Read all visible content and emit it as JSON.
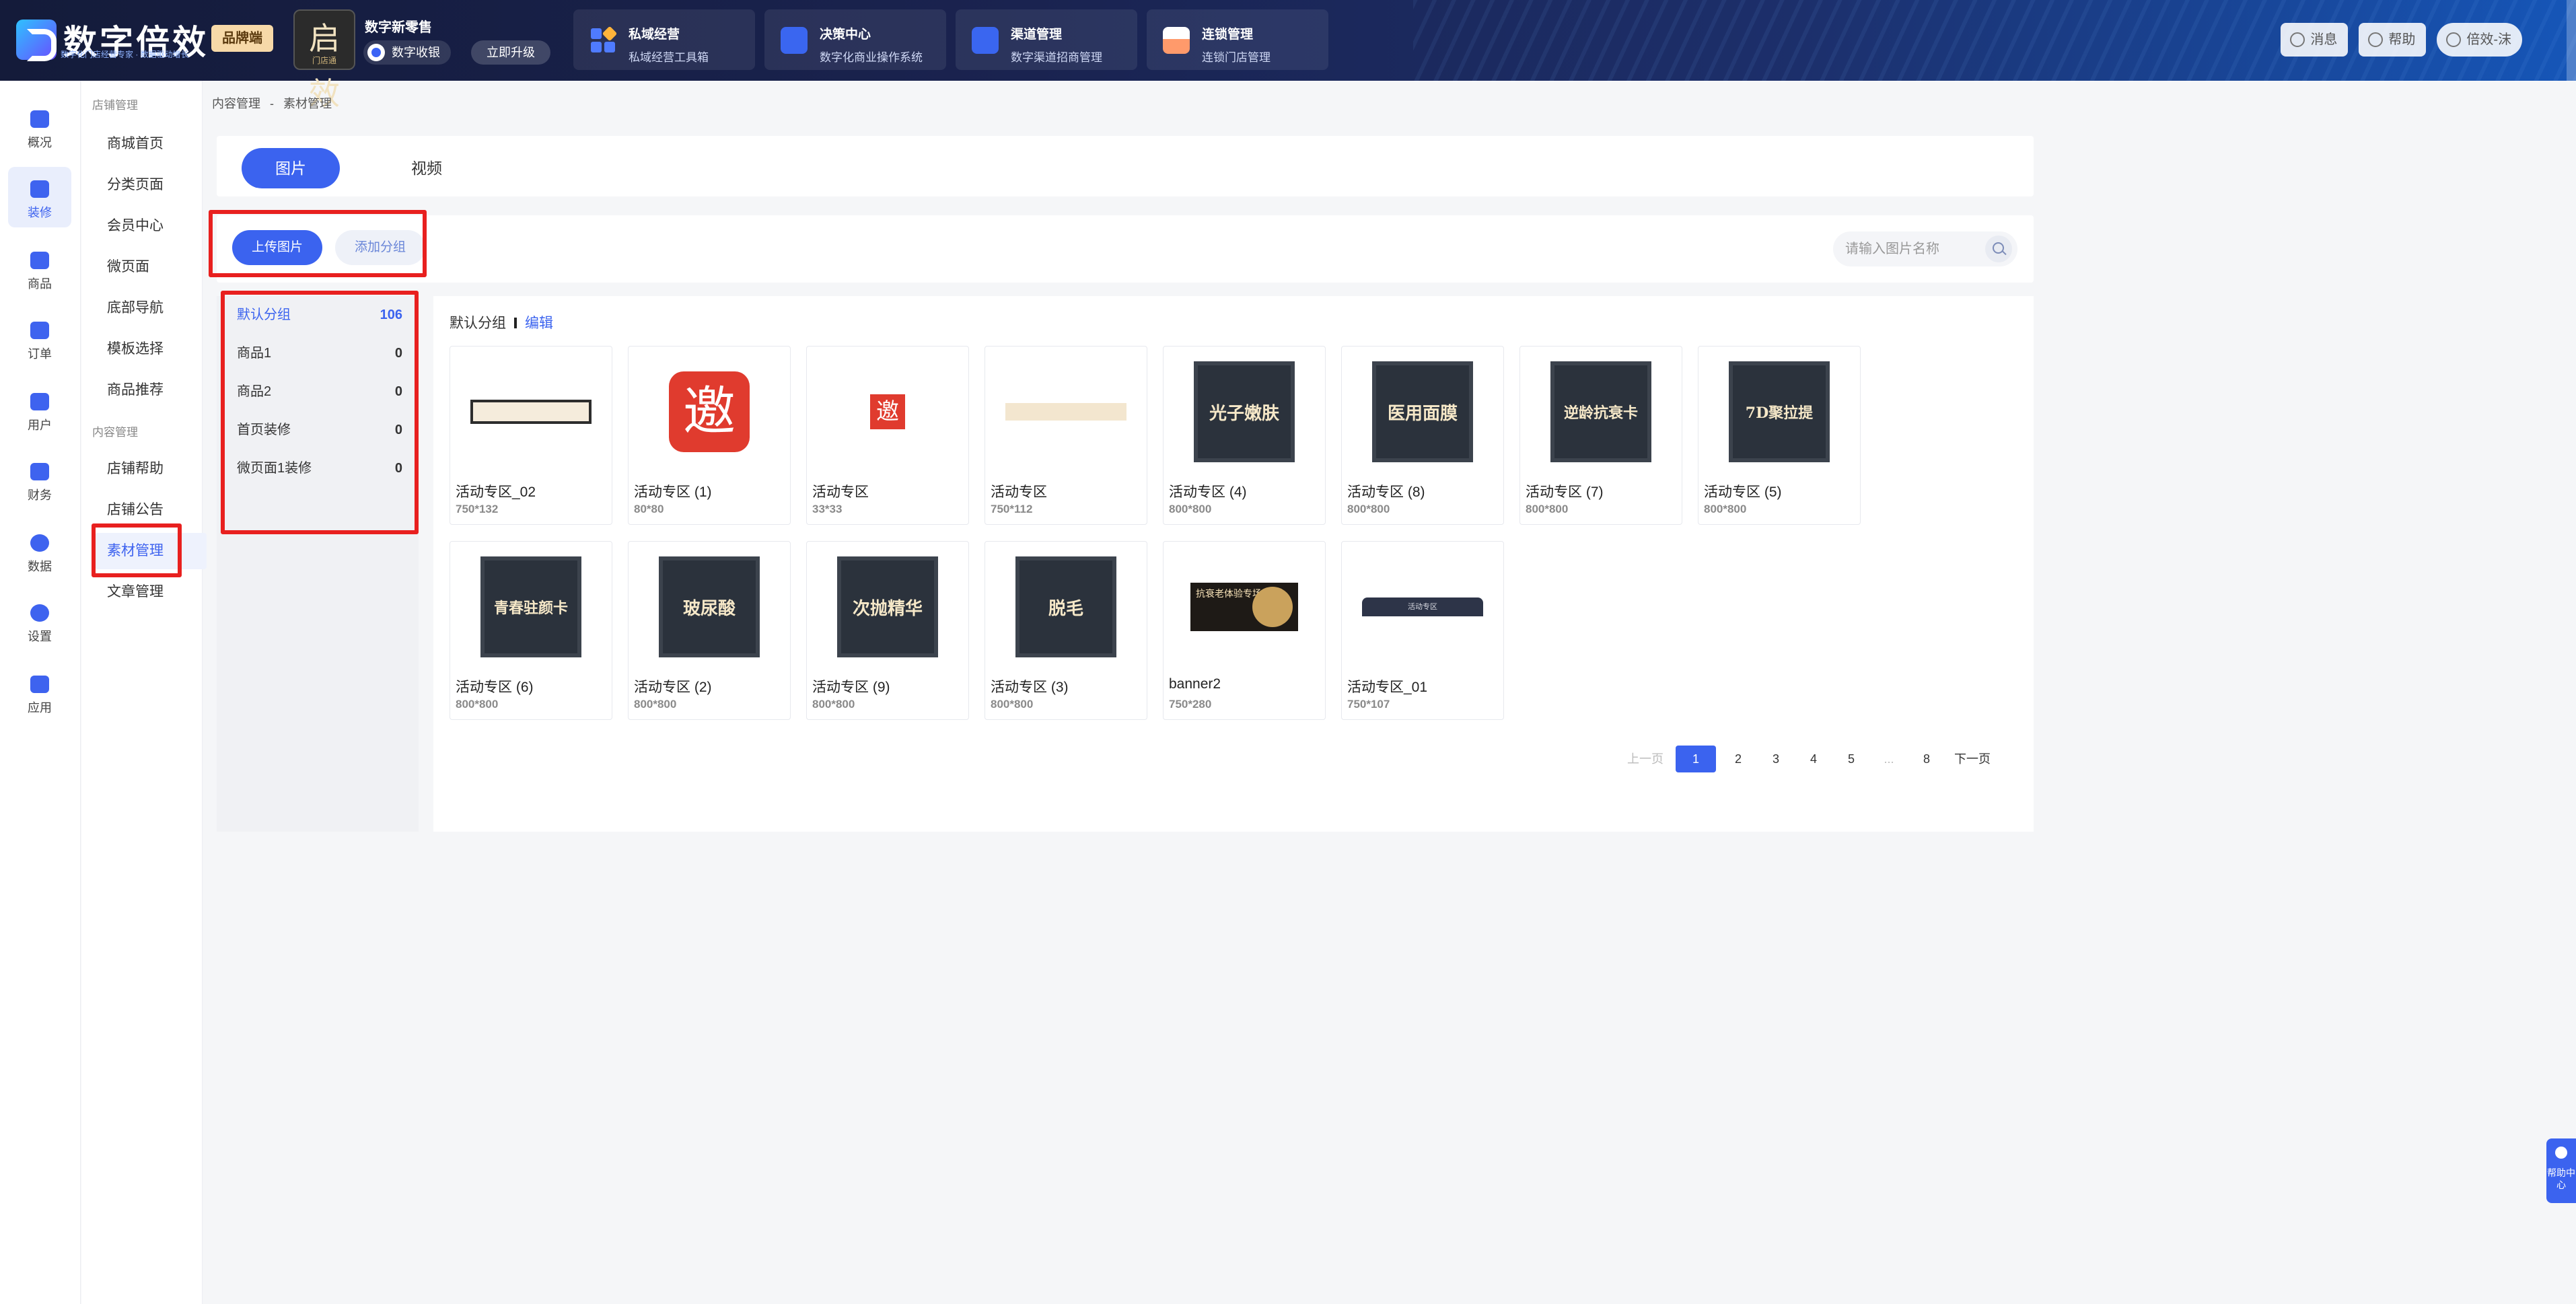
{
  "header": {
    "logo_text": "数字倍效",
    "logo_sub": "数字化门店经营专家 · 数据驱动增长",
    "brand_tag": "品牌端",
    "store_avatar_text": "启效",
    "store_avatar_sub": "门店通",
    "store_name": "数字新零售",
    "store_badge": "数字收银",
    "upgrade": "立即升级",
    "nav_cards": [
      {
        "title": "私域经营",
        "sub": "私域经营工具箱"
      },
      {
        "title": "决策中心",
        "sub": "数字化商业操作系统"
      },
      {
        "title": "渠道管理",
        "sub": "数字渠道招商管理"
      },
      {
        "title": "连锁管理",
        "sub": "连锁门店管理"
      }
    ],
    "actions": {
      "message": "消息",
      "help": "帮助",
      "user": "倍效-沫"
    }
  },
  "rail": [
    {
      "label": "概况"
    },
    {
      "label": "装修"
    },
    {
      "label": "商品"
    },
    {
      "label": "订单"
    },
    {
      "label": "用户"
    },
    {
      "label": "财务"
    },
    {
      "label": "数据"
    },
    {
      "label": "设置"
    },
    {
      "label": "应用"
    }
  ],
  "menu": {
    "group1": "店铺管理",
    "items1": [
      "商城首页",
      "分类页面",
      "会员中心",
      "微页面",
      "底部导航",
      "模板选择",
      "商品推荐"
    ],
    "group2": "内容管理",
    "items2": [
      "店铺帮助",
      "店铺公告",
      "素材管理",
      "文章管理"
    ]
  },
  "breadcrumb": [
    "内容管理",
    "-",
    "素材管理"
  ],
  "tabs": [
    "图片",
    "视频"
  ],
  "toolbar": {
    "upload": "上传图片",
    "add_group": "添加分组",
    "search_placeholder": "请输入图片名称"
  },
  "groups": [
    {
      "name": "默认分组",
      "count": "106"
    },
    {
      "name": "商品1",
      "count": "0"
    },
    {
      "name": "商品2",
      "count": "0"
    },
    {
      "name": "首页装修",
      "count": "0"
    },
    {
      "name": "微页面1装修",
      "count": "0"
    }
  ],
  "grid_head": {
    "group": "默认分组",
    "edit": "编辑"
  },
  "images": [
    {
      "name": "活动专区_02",
      "size": "750*132",
      "thumb_text": ""
    },
    {
      "name": "活动专区 (1)",
      "size": "80*80",
      "thumb_text": "邀"
    },
    {
      "name": "活动专区",
      "size": "33*33",
      "thumb_text": "邀"
    },
    {
      "name": "活动专区",
      "size": "750*112",
      "thumb_text": ""
    },
    {
      "name": "活动专区 (4)",
      "size": "800*800",
      "thumb_text": "光子嫩肤"
    },
    {
      "name": "活动专区 (8)",
      "size": "800*800",
      "thumb_text": "医用面膜"
    },
    {
      "name": "活动专区 (7)",
      "size": "800*800",
      "thumb_text": "逆龄抗衰卡"
    },
    {
      "name": "活动专区 (5)",
      "size": "800*800",
      "thumb_text": "7D聚拉提"
    },
    {
      "name": "活动专区 (6)",
      "size": "800*800",
      "thumb_text": "青春驻颜卡"
    },
    {
      "name": "活动专区 (2)",
      "size": "800*800",
      "thumb_text": "玻尿酸"
    },
    {
      "name": "活动专区 (9)",
      "size": "800*800",
      "thumb_text": "次抛精华"
    },
    {
      "name": "活动专区 (3)",
      "size": "800*800",
      "thumb_text": "脱毛"
    },
    {
      "name": "banner2",
      "size": "750*280",
      "thumb_text": "抗衰老体验专场"
    },
    {
      "name": "活动专区_01",
      "size": "750*107",
      "thumb_text": "活动专区"
    }
  ],
  "pagination": {
    "prev": "上一页",
    "pages": [
      "1",
      "2",
      "3",
      "4",
      "5",
      "...",
      "8"
    ],
    "next": "下一页",
    "current": "1"
  },
  "help_float": "帮助中心",
  "colors": {
    "accent": "#3b63ef",
    "highlight_box": "#e8201f",
    "header_bg": "#141b3a"
  }
}
